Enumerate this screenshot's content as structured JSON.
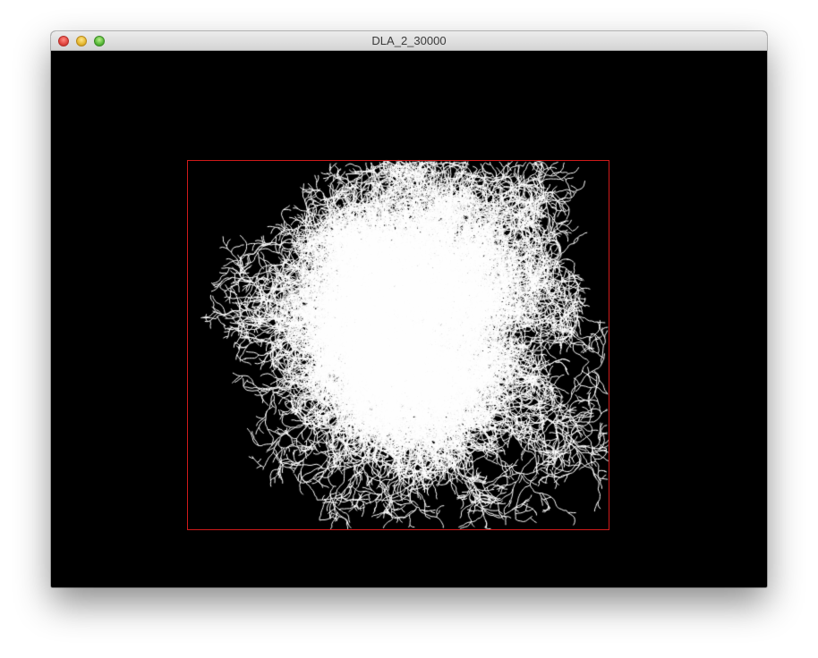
{
  "window": {
    "title": "DLA_2_30000",
    "buttons": {
      "close": "close-button",
      "minimize": "minimize-button",
      "zoom": "zoom-button"
    }
  },
  "canvas": {
    "background": "#000000",
    "bounds_color": "#d01a1a",
    "particle_color": "#ffffff",
    "particle_count": 30000
  }
}
